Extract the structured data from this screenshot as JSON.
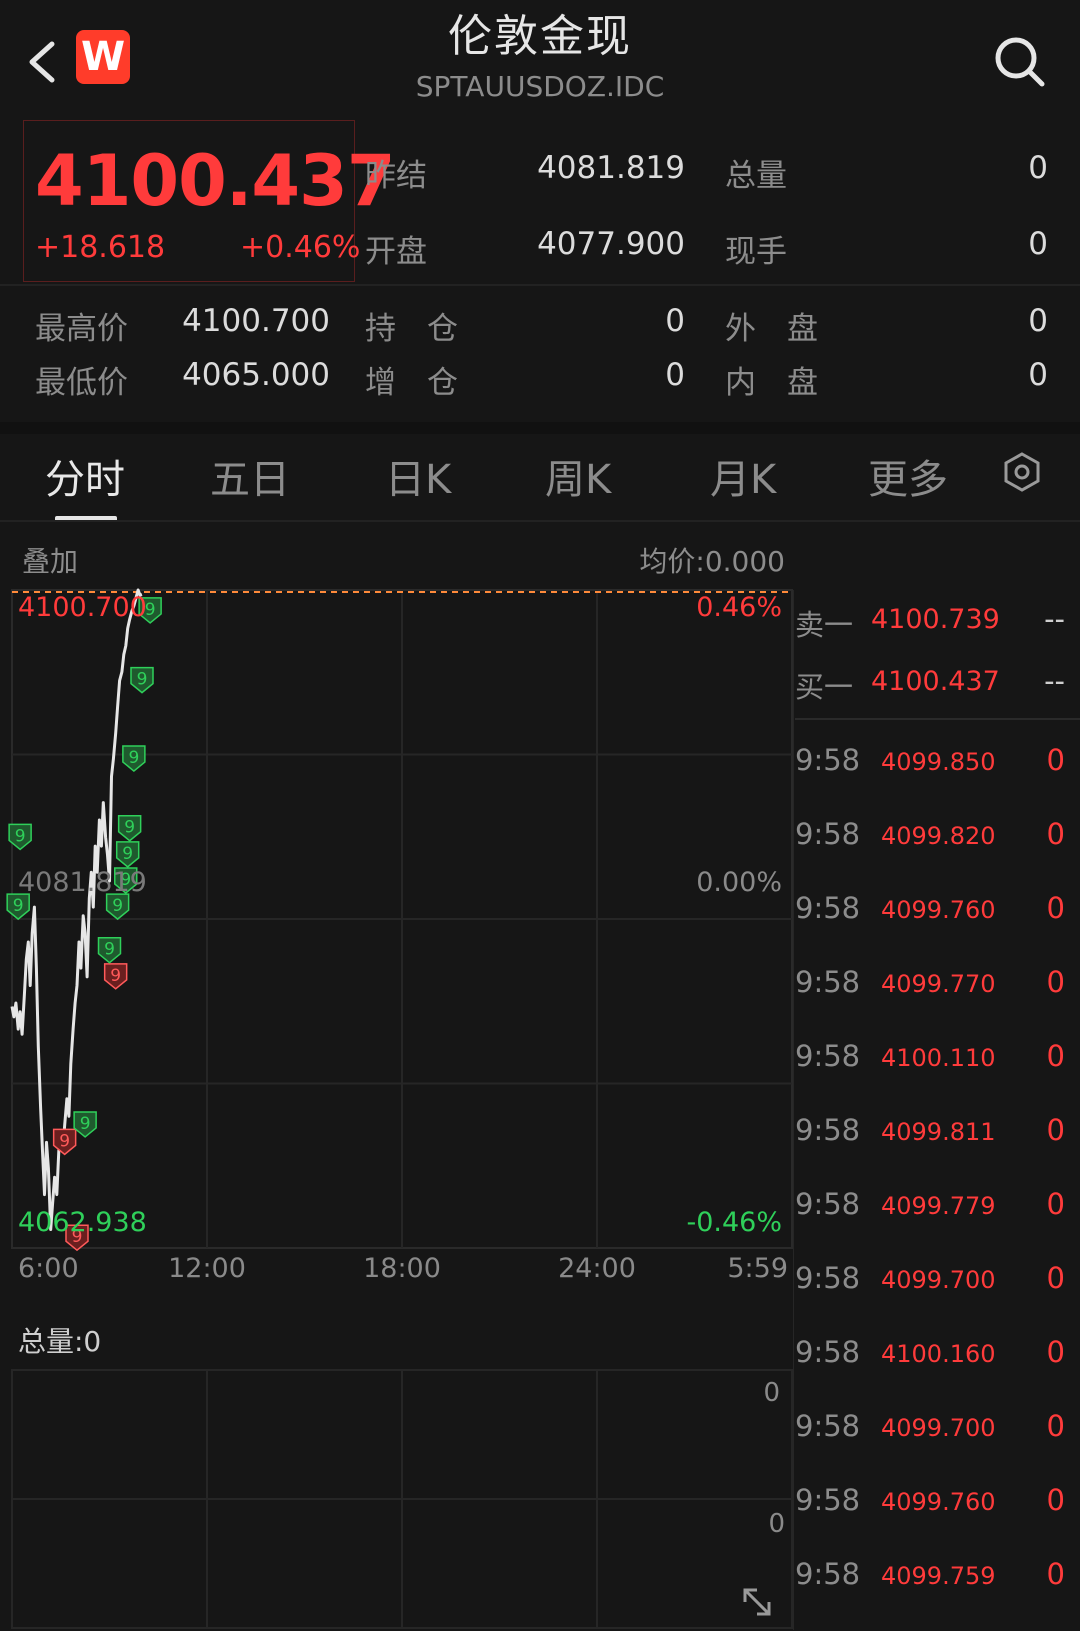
{
  "header": {
    "title": "伦敦金现",
    "subtitle": "SPTAUUSDOZ.IDC",
    "logo_letter": "W"
  },
  "quote": {
    "price": "4100.437",
    "change": "+18.618",
    "change_pct": "+0.46%",
    "fields": [
      {
        "label": "昨结",
        "value": "4081.819"
      },
      {
        "label": "总量",
        "value": "0"
      },
      {
        "label": "开盘",
        "value": "4077.900"
      },
      {
        "label": "现手",
        "value": "0"
      },
      {
        "label": "最高价",
        "value": "4100.700"
      },
      {
        "label": "持　仓",
        "value": "0"
      },
      {
        "label": "外　盘",
        "value": "0"
      },
      {
        "label": "最低价",
        "value": "4065.000"
      },
      {
        "label": "增　仓",
        "value": "0"
      },
      {
        "label": "内　盘",
        "value": "0"
      }
    ]
  },
  "tabs": [
    "分时",
    "五日",
    "日K",
    "周K",
    "月K",
    "更多"
  ],
  "overlay_label": "叠加",
  "avg_price": "均价:0.000",
  "volume_label": "总量:0",
  "volume_ticks": [
    "0",
    "0"
  ],
  "colors": {
    "up": "#ff3b3b",
    "down": "#2fd05a",
    "bg": "#161616"
  },
  "chart_data": {
    "type": "line",
    "y_labels": {
      "top": "4100.700",
      "mid": "4081.819",
      "bottom": "4062.938"
    },
    "pct_labels": {
      "top": "0.46%",
      "mid": "0.00%",
      "bottom": "-0.46%"
    },
    "x_ticks": [
      "6:00",
      "12:00",
      "18:00",
      "24:00",
      "5:59"
    ],
    "ylim": [
      4062.938,
      4100.7
    ],
    "x_hours": [
      0,
      0.06,
      0.12,
      0.19,
      0.25,
      0.31,
      0.38,
      0.44,
      0.5,
      0.56,
      0.62,
      0.69,
      0.75,
      0.81,
      0.88,
      0.94,
      1.0,
      1.06,
      1.12,
      1.19,
      1.25,
      1.31,
      1.38,
      1.44,
      1.5,
      1.56,
      1.62,
      1.69,
      1.75,
      1.81,
      1.88,
      1.94,
      2.0,
      2.06,
      2.12,
      2.19,
      2.25,
      2.31,
      2.38,
      2.44,
      2.5,
      2.56,
      2.62,
      2.69,
      2.75,
      2.81,
      2.88,
      2.94,
      3.0,
      3.06,
      3.12,
      3.19,
      3.25,
      3.31,
      3.38,
      3.44,
      3.5,
      3.56,
      3.62,
      3.69,
      3.75,
      3.81,
      3.88,
      3.94,
      4.0
    ],
    "values": [
      4076.8,
      4076.2,
      4077.0,
      4075.5,
      4076.5,
      4075.2,
      4077.5,
      4079.5,
      4080.5,
      4078.0,
      4081.0,
      4082.5,
      4079.0,
      4074.5,
      4071.0,
      4068.5,
      4066.0,
      4069.0,
      4067.5,
      4064.0,
      4065.5,
      4067.0,
      4066.0,
      4068.5,
      4069.5,
      4068.5,
      4070.0,
      4071.5,
      4070.5,
      4073.5,
      4075.5,
      4077.0,
      4078.0,
      4080.5,
      4079.0,
      4082.0,
      4081.0,
      4078.5,
      4083.0,
      4084.5,
      4082.5,
      4086.0,
      4084.5,
      4087.5,
      4086.0,
      4088.5,
      4086.5,
      4085.5,
      4084.0,
      4090.0,
      4091.0,
      4092.5,
      4094.0,
      4095.5,
      4096.0,
      4097.0,
      4097.5,
      4098.5,
      4099.0,
      4099.5,
      4099.8,
      4100.2,
      4100.7,
      4100.4,
      4100.437
    ],
    "signals": [
      {
        "x": 0.25,
        "v": 4086.5,
        "color": "green",
        "text": "9"
      },
      {
        "x": 0.19,
        "v": 4082.5,
        "color": "green",
        "text": "9"
      },
      {
        "x": 1.62,
        "v": 4069.0,
        "color": "red",
        "text": "9"
      },
      {
        "x": 2.25,
        "v": 4070.0,
        "color": "green",
        "text": "9"
      },
      {
        "x": 2.0,
        "v": 4063.5,
        "color": "red",
        "text": "9"
      },
      {
        "x": 3.19,
        "v": 4078.5,
        "color": "red",
        "text": "9"
      },
      {
        "x": 3.0,
        "v": 4080.0,
        "color": "green",
        "text": "9"
      },
      {
        "x": 3.25,
        "v": 4082.5,
        "color": "green",
        "text": "9"
      },
      {
        "x": 3.5,
        "v": 4084.0,
        "color": "green",
        "text": "9"
      },
      {
        "x": 3.56,
        "v": 4085.5,
        "color": "green",
        "text": "9"
      },
      {
        "x": 3.62,
        "v": 4087.0,
        "color": "green",
        "text": "9"
      },
      {
        "x": 3.75,
        "v": 4091.0,
        "color": "green",
        "text": "9"
      },
      {
        "x": 4.0,
        "v": 4095.5,
        "color": "green",
        "text": "9"
      },
      {
        "x": 4.25,
        "v": 4099.5,
        "color": "green",
        "text": "9"
      }
    ]
  },
  "order_book": [
    {
      "label": "卖一",
      "price": "4100.739",
      "qty": "--"
    },
    {
      "label": "买一",
      "price": "4100.437",
      "qty": "--"
    }
  ],
  "trades": [
    {
      "time": "9:58",
      "price": "4099.850",
      "qty": "0"
    },
    {
      "time": "9:58",
      "price": "4099.820",
      "qty": "0"
    },
    {
      "time": "9:58",
      "price": "4099.760",
      "qty": "0"
    },
    {
      "time": "9:58",
      "price": "4099.770",
      "qty": "0"
    },
    {
      "time": "9:58",
      "price": "4100.110",
      "qty": "0"
    },
    {
      "time": "9:58",
      "price": "4099.811",
      "qty": "0"
    },
    {
      "time": "9:58",
      "price": "4099.779",
      "qty": "0"
    },
    {
      "time": "9:58",
      "price": "4099.700",
      "qty": "0"
    },
    {
      "time": "9:58",
      "price": "4100.160",
      "qty": "0"
    },
    {
      "time": "9:58",
      "price": "4099.700",
      "qty": "0"
    },
    {
      "time": "9:58",
      "price": "4099.760",
      "qty": "0"
    },
    {
      "time": "9:58",
      "price": "4099.759",
      "qty": "0"
    }
  ]
}
